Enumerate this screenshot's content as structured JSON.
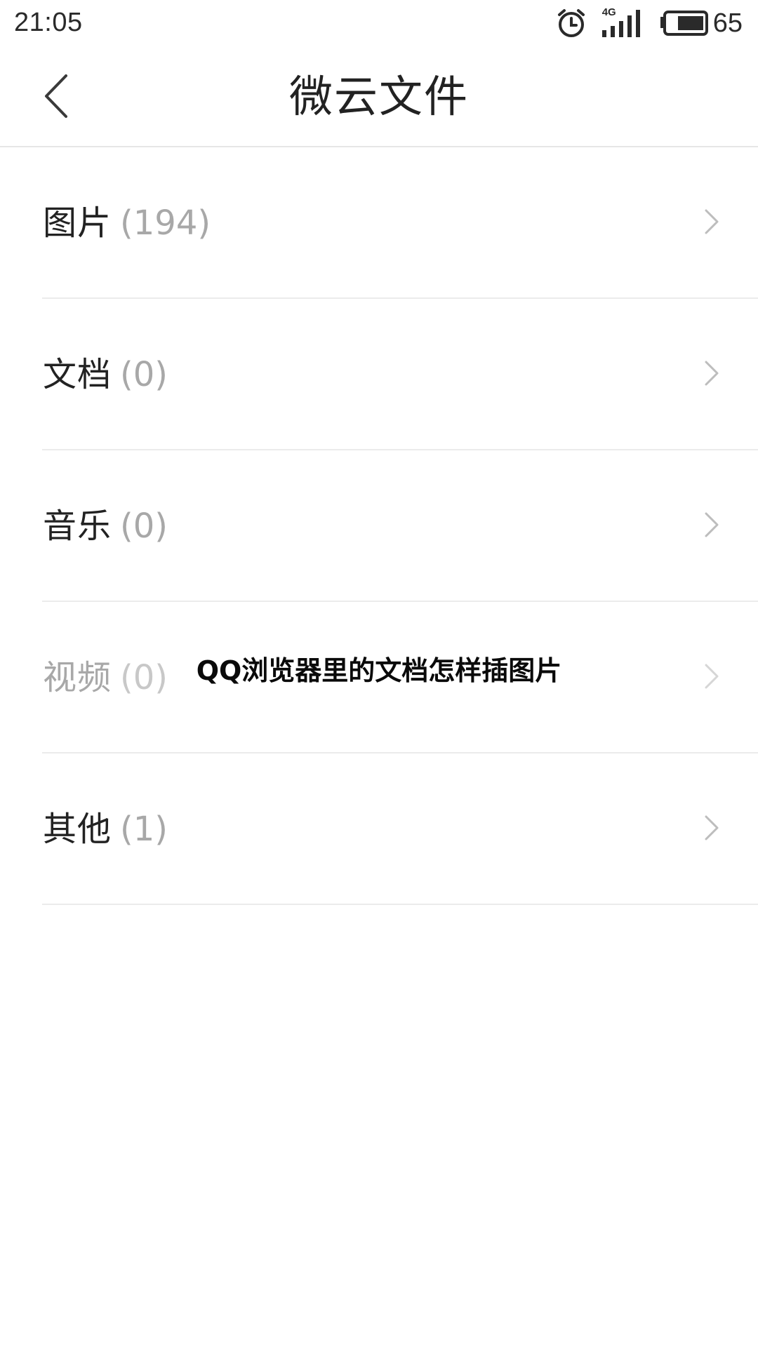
{
  "status_bar": {
    "time": "21:05",
    "network_label": "4G",
    "battery_level": "65",
    "icons": [
      "alarm-icon",
      "signal-icon",
      "battery-icon"
    ]
  },
  "header": {
    "title": "微云文件",
    "back_icon": "back-arrow-icon"
  },
  "categories": [
    {
      "label": "图片",
      "count": "(194)",
      "icon": "chevron-right-icon"
    },
    {
      "label": "文档",
      "count": "(0)",
      "icon": "chevron-right-icon"
    },
    {
      "label": "音乐",
      "count": "(0)",
      "icon": "chevron-right-icon"
    },
    {
      "label": "视频",
      "count": "(0)",
      "icon": "chevron-right-icon"
    },
    {
      "label": "其他",
      "count": "(1)",
      "icon": "chevron-right-icon"
    }
  ],
  "overlay": {
    "caption": "QQ浏览器里的文档怎样插图片"
  },
  "colors": {
    "text_primary": "#222222",
    "text_secondary": "#a8a8a8",
    "divider": "#ebebeb",
    "background": "#ffffff"
  }
}
